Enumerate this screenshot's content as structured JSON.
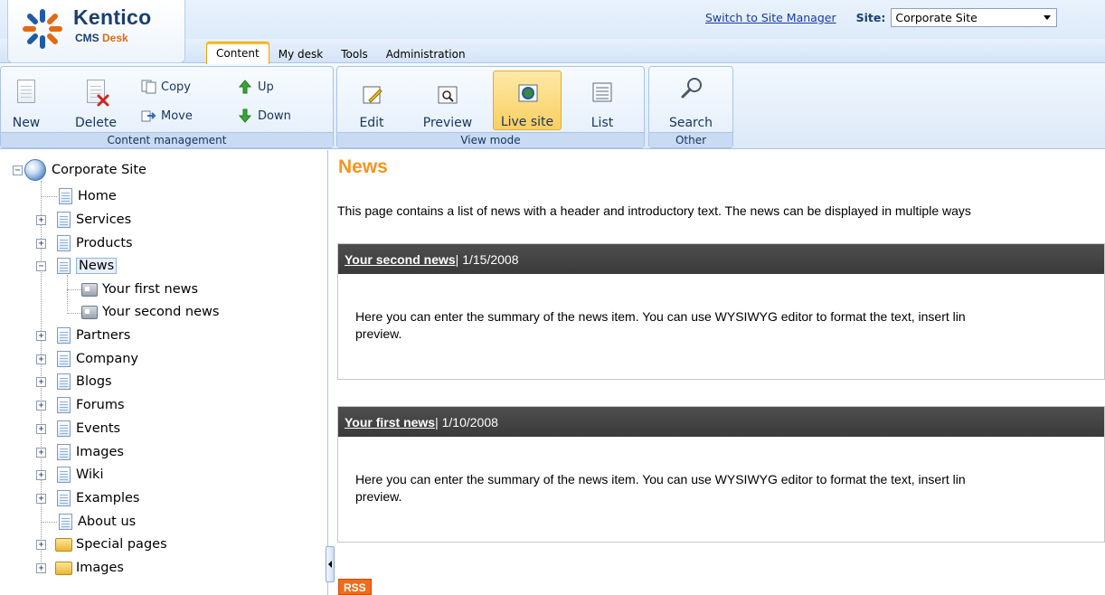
{
  "header": {
    "logo_title": "Kentico",
    "logo_sub_cms": "CMS",
    "logo_sub_desk": "Desk",
    "switch_link": "Switch to Site Manager",
    "site_label": "Site:",
    "site_value": "Corporate Site",
    "tabs": [
      {
        "label": "Content",
        "active": true
      },
      {
        "label": "My desk"
      },
      {
        "label": "Tools"
      },
      {
        "label": "Administration"
      }
    ]
  },
  "toolbar": {
    "content_management": {
      "caption": "Content management",
      "new": "New",
      "delete": "Delete",
      "copy": "Copy",
      "move": "Move",
      "up": "Up",
      "down": "Down"
    },
    "view_mode": {
      "caption": "View mode",
      "edit": "Edit",
      "preview": "Preview",
      "live_site": "Live site",
      "list": "List",
      "selected": "Live site"
    },
    "other": {
      "caption": "Other",
      "search": "Search"
    }
  },
  "tree": {
    "root": "Corporate Site",
    "items": [
      {
        "label": "Home"
      },
      {
        "label": "Services"
      },
      {
        "label": "Products"
      },
      {
        "label": "News",
        "selected": true,
        "expanded": true,
        "children": [
          {
            "label": "Your first news"
          },
          {
            "label": "Your second news"
          }
        ]
      },
      {
        "label": "Partners"
      },
      {
        "label": "Company"
      },
      {
        "label": "Blogs"
      },
      {
        "label": "Forums"
      },
      {
        "label": "Events"
      },
      {
        "label": "Images"
      },
      {
        "label": "Wiki"
      },
      {
        "label": "Examples"
      },
      {
        "label": "About us"
      },
      {
        "label": "Special pages"
      },
      {
        "label": "Images"
      }
    ]
  },
  "content": {
    "title": "News",
    "intro": "This page contains a list of news with a header and introductory text. The news can be displayed in multiple ways",
    "news": [
      {
        "title": "Your second news",
        "date": " | 1/15/2008",
        "summary_line1": "Here you can enter the summary of the news item. You can use WYSIWYG editor to format the text, insert lin",
        "summary_line2": "preview."
      },
      {
        "title": "Your first news",
        "date": " | 1/10/2008",
        "summary_line1": "Here you can enter the summary of the news item. You can use WYSIWYG editor to format the text, insert lin",
        "summary_line2": "preview."
      }
    ],
    "rss": "RSS"
  },
  "colors": {
    "title_orange": "#f7941d",
    "news_header": "#444444",
    "toolbar_blue": "#dde9f7",
    "active_tab_border": "#f0a400",
    "rss_orange": "#f26a1b"
  }
}
